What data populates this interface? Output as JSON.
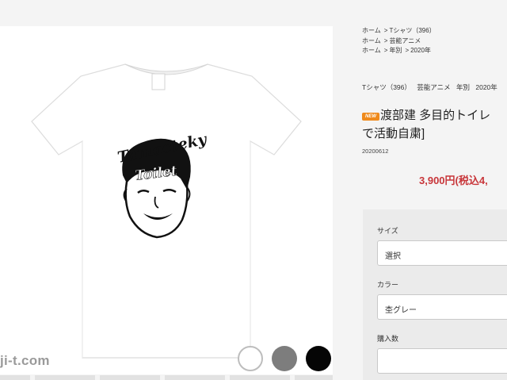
{
  "product_image": {
    "graphic_text": [
      "Tamocteky",
      "Toilet"
    ],
    "watermark": "ji-t.com",
    "color_swatches": [
      {
        "name": "white",
        "color": "#ffffff"
      },
      {
        "name": "gray",
        "color": "#7d7d7d"
      },
      {
        "name": "black",
        "color": "#050505"
      }
    ]
  },
  "breadcrumbs": [
    [
      "ホーム",
      "Tシャツ（396）"
    ],
    [
      "ホーム",
      "芸能アニメ"
    ],
    [
      "ホーム",
      "年別",
      "2020年"
    ]
  ],
  "breadcrumb_separator": ">",
  "category_tags": [
    "Tシャツ（396）",
    "芸能アニメ",
    "年別",
    "2020年"
  ],
  "product": {
    "badge": "NEW",
    "title_line1": "渡部建 多目的トイレ",
    "title_line2": "で活動自粛]",
    "code": "20200612",
    "price": "3,900円(税込4,"
  },
  "options": {
    "size": {
      "label": "サイズ",
      "value": "選択"
    },
    "color": {
      "label": "カラー",
      "value": "杢グレー"
    },
    "quantity": {
      "label": "購入数",
      "value": ""
    }
  },
  "colors": {
    "accent_price": "#c8363a",
    "badge": "#ef8a1c"
  }
}
